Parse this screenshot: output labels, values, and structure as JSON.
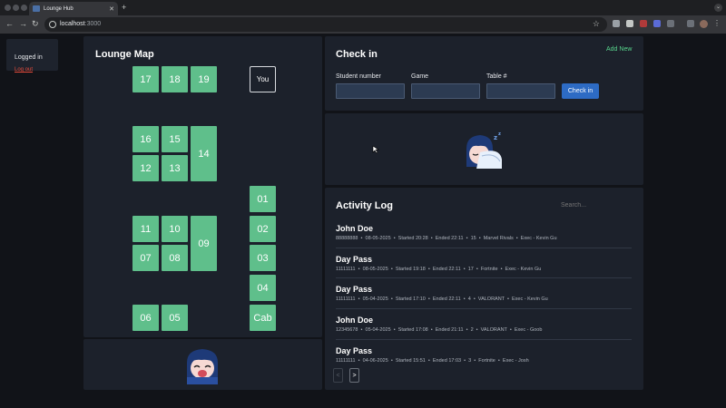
{
  "browser": {
    "tab_title": "Lounge Hub",
    "url_host": "localhost",
    "url_port": ":3000"
  },
  "session": {
    "status": "Logged in",
    "logout_label": "Log out"
  },
  "map": {
    "title": "Lounge Map",
    "you_label": "You",
    "stations": [
      {
        "id": "s17",
        "label": "17"
      },
      {
        "id": "s18",
        "label": "18"
      },
      {
        "id": "s19",
        "label": "19"
      },
      {
        "id": "s16",
        "label": "16"
      },
      {
        "id": "s15",
        "label": "15"
      },
      {
        "id": "s12",
        "label": "12"
      },
      {
        "id": "s13",
        "label": "13"
      },
      {
        "id": "s14",
        "label": "14"
      },
      {
        "id": "s11",
        "label": "11"
      },
      {
        "id": "s10",
        "label": "10"
      },
      {
        "id": "s07",
        "label": "07"
      },
      {
        "id": "s08",
        "label": "08"
      },
      {
        "id": "s09",
        "label": "09"
      },
      {
        "id": "s06",
        "label": "06"
      },
      {
        "id": "s05",
        "label": "05"
      },
      {
        "id": "s01",
        "label": "01"
      },
      {
        "id": "s02",
        "label": "02"
      },
      {
        "id": "s03",
        "label": "03"
      },
      {
        "id": "s04",
        "label": "04"
      },
      {
        "id": "scab",
        "label": "Cab"
      }
    ]
  },
  "checkin": {
    "title": "Check in",
    "add_new_label": "Add New",
    "student_number_label": "Student number",
    "game_label": "Game",
    "table_label": "Table #",
    "button_label": "Check in"
  },
  "activity": {
    "title": "Activity Log",
    "search_placeholder": "Search...",
    "entries": [
      {
        "name": "John Doe",
        "meta": "88888888  •  08-05-2025  •  Started 20:28  •  Ended 22:11  •  15  •  Marvel Rivals  •  Exec - Kevin Gu"
      },
      {
        "name": "Day Pass",
        "meta": "11111111  •  08-05-2025  •  Started 19:18  •  Ended 22:11  •  17  •  Fortnite  •  Exec - Kevin Gu"
      },
      {
        "name": "Day Pass",
        "meta": "11111111  •  05-04-2025  •  Started 17:10  •  Ended 22:11  •  4  •  VALORANT  •  Exec - Kevin Gu"
      },
      {
        "name": "John Doe",
        "meta": "12345678  •  05-04-2025  •  Started 17:08  •  Ended 21:11  •  2  •  VALORANT  •  Exec - Goob"
      },
      {
        "name": "Day Pass",
        "meta": "11111111  •  04-06-2025  •  Started 15:51  •  Ended 17:03  •  3  •  Fortnite  •  Exec - Josh"
      }
    ],
    "prev_label": "<",
    "next_label": ">"
  }
}
